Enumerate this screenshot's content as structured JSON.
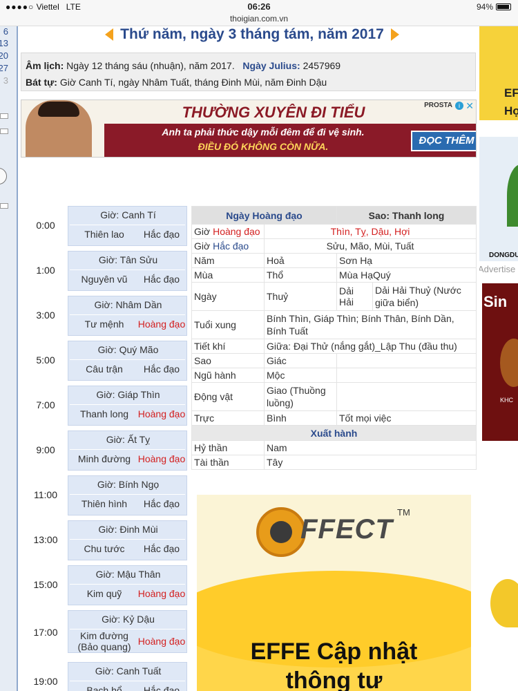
{
  "status_bar": {
    "signal": "●●●●○",
    "carrier": "Viettel",
    "network": "LTE",
    "time": "06:26",
    "url": "thoigian.com.vn",
    "battery": "94%"
  },
  "left_rail": {
    "numbers": [
      "6",
      "13",
      "20",
      "27",
      "3"
    ]
  },
  "header": {
    "title": "Thứ năm, ngày 3 tháng tám, năm 2017"
  },
  "info": {
    "lunar_label": "Âm lịch:",
    "lunar_value": "Ngày 12 tháng sáu (nhuận), năm 2017.",
    "julius_label": "Ngày Julius:",
    "julius_value": "2457969",
    "battu_label": "Bát tự:",
    "battu_value": "Giờ Canh Tí, ngày Nhâm Tuất, tháng Đinh Mùi, năm Đinh Dậu"
  },
  "banner_ad": {
    "headline": "THƯỜNG XUYÊN ĐI TIỂU",
    "line1": "Anh ta phải thức dậy mỗi đêm để đi vệ sinh.",
    "line2": "ĐIỀU ĐÓ KHÔNG CÒN NỮA.",
    "cta": "ĐỌC THÊM >",
    "brand": "PROSTA",
    "info_glyph": "i",
    "close_glyph": "✕"
  },
  "hours": [
    {
      "time": "0:00",
      "name": "Giờ: Canh Tí",
      "star": "Thiên lao",
      "type": "Hắc đạo",
      "kind": "hac"
    },
    {
      "time": "1:00",
      "name": "Giờ: Tân Sửu",
      "star": "Nguyên vũ",
      "type": "Hắc đạo",
      "kind": "hac"
    },
    {
      "time": "3:00",
      "name": "Giờ: Nhâm Dần",
      "star": "Tư mệnh",
      "type": "Hoàng đạo",
      "kind": "hoang"
    },
    {
      "time": "5:00",
      "name": "Giờ: Quý Mão",
      "star": "Câu trận",
      "type": "Hắc đạo",
      "kind": "hac"
    },
    {
      "time": "7:00",
      "name": "Giờ: Giáp Thìn",
      "star": "Thanh long",
      "type": "Hoàng đạo",
      "kind": "hoang"
    },
    {
      "time": "9:00",
      "name": "Giờ: Ất Tỵ",
      "star": "Minh đường",
      "type": "Hoàng đạo",
      "kind": "hoang"
    },
    {
      "time": "11:00",
      "name": "Giờ: Bính Ngọ",
      "star": "Thiên hình",
      "type": "Hắc đạo",
      "kind": "hac"
    },
    {
      "time": "13:00",
      "name": "Giờ: Đinh Mùi",
      "star": "Chu tước",
      "type": "Hắc đạo",
      "kind": "hac"
    },
    {
      "time": "15:00",
      "name": "Giờ: Mậu Thân",
      "star": "Kim quỹ",
      "type": "Hoàng đạo",
      "kind": "hoang"
    },
    {
      "time": "17:00",
      "name": "Giờ: Kỷ Dậu",
      "star": "Kim đường (Bảo quang)",
      "type": "Hoàng đạo",
      "kind": "hoang"
    },
    {
      "time": "19:00",
      "name": "Giờ: Canh Tuất",
      "star": "Bạch hổ",
      "type": "Hắc đạo",
      "kind": "hac"
    }
  ],
  "details": {
    "header_left": "Ngày Hoàng đạo",
    "header_right": "Sao: Thanh long",
    "gio_label": "Giờ",
    "hoang_dao": "Hoàng đạo",
    "hoang_dao_hours": "Thìn, Tỵ, Dậu, Hợi",
    "hac_dao": "Hắc đạo",
    "hac_dao_hours": "Sửu, Mão, Mùi, Tuất",
    "rows": {
      "nam": [
        "Năm",
        "Hoả",
        "Sơn Hạ"
      ],
      "mua": [
        "Mùa",
        "Thổ",
        "Mùa Hạ",
        "Quý"
      ],
      "ngay": [
        "Ngày",
        "Thuỷ",
        "Dải Hải",
        "Dải Hải Thuỷ (Nước giữa biển)"
      ],
      "tuoi": [
        "Tuổi xung",
        "Bính Thìn, Giáp Thìn; Bính Thân, Bính Dần, Bính Tuất"
      ],
      "tiet": [
        "Tiết khí",
        "Giữa: Đại Thử (nắng gắt)_Lập Thu (đầu thu)"
      ],
      "sao": [
        "Sao",
        "Giác"
      ],
      "ngu": [
        "Ngũ hành",
        "Mộc"
      ],
      "dong": [
        "Động vật",
        "Giao (Thuồng luồng)"
      ],
      "truc": [
        "Trực",
        "Bình",
        "Tốt mọi việc"
      ]
    },
    "xuat_hanh": "Xuất hành",
    "hy_than": [
      "Hỷ thần",
      "Nam"
    ],
    "tai_than": [
      "Tài thần",
      "Tây"
    ]
  },
  "effect_ad": {
    "logo": "FFECT",
    "tm": "TM",
    "headline_1": "EFFE Cập nhật",
    "headline_2": "thông tư"
  },
  "right_ads": {
    "ad1_text": "EF\nHọ",
    "ad2_text": "DONGDU",
    "advertise": "Advertise",
    "ad3_text": "Sin",
    "ad3_sub": "KHC"
  }
}
